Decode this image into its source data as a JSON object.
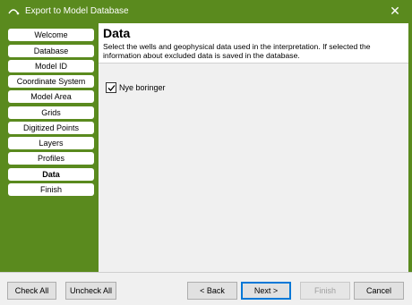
{
  "window": {
    "title": "Export to Model Database",
    "close_symbol": "✕"
  },
  "sidebar": {
    "items": [
      {
        "label": "Welcome"
      },
      {
        "label": "Database"
      },
      {
        "label": "Model ID"
      },
      {
        "label": "Coordinate System"
      },
      {
        "label": "Model Area"
      },
      {
        "label": "Grids"
      },
      {
        "label": "Digitized Points"
      },
      {
        "label": "Layers"
      },
      {
        "label": "Profiles"
      },
      {
        "label": "Data"
      },
      {
        "label": "Finish"
      }
    ],
    "active_index": 9
  },
  "main": {
    "title": "Data",
    "description": "Select the wells and geophysical data used in the interpretation. If selected the information about excluded data is saved in the database.",
    "checkbox": {
      "label": "Nye boringer",
      "checked": true
    }
  },
  "footer": {
    "check_all": "Check All",
    "uncheck_all": "Uncheck All",
    "back": "< Back",
    "next": "Next >",
    "finish": "Finish",
    "cancel": "Cancel"
  },
  "colors": {
    "frame": "#5a8a1e",
    "accent": "#0078d7"
  },
  "icons": {
    "app": "app-icon",
    "close": "close-icon",
    "check": "checkmark-icon"
  }
}
